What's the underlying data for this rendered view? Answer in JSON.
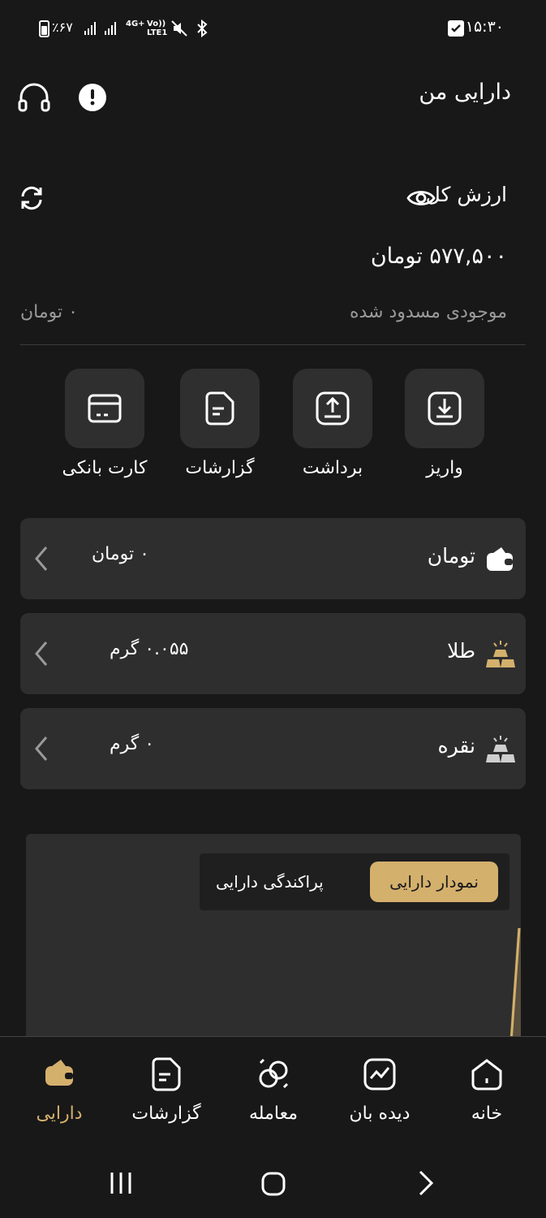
{
  "status_bar": {
    "time": "۱۵:۳۰",
    "battery": "٪۶۷",
    "network": "4G+",
    "volte": "Vo)) LTE1"
  },
  "header": {
    "title": "دارایی من"
  },
  "total": {
    "label": "ارزش کل",
    "amount": "۵۷۷,۵۰۰ تومان",
    "blocked_label": "موجودی مسدود شده",
    "blocked_value": "۰ تومان"
  },
  "actions": [
    {
      "label": "واریز",
      "icon": "deposit-icon"
    },
    {
      "label": "برداشت",
      "icon": "withdraw-icon"
    },
    {
      "label": "گزارشات",
      "icon": "report-icon"
    },
    {
      "label": "کارت بانکی",
      "icon": "card-icon"
    }
  ],
  "assets": [
    {
      "name": "تومان",
      "value": "۰ تومان",
      "icon": "wallet-icon"
    },
    {
      "name": "طلا",
      "value": "۰.۰۵۵ گرم",
      "icon": "gold-bars-icon"
    },
    {
      "name": "نقره",
      "value": "۰ گرم",
      "icon": "silver-bars-icon"
    }
  ],
  "chart_tabs": {
    "active": "نمودار دارایی",
    "inactive": "پراکندگی دارایی"
  },
  "bottom_nav": [
    {
      "label": "خانه",
      "icon": "home-icon"
    },
    {
      "label": "دیده بان",
      "icon": "watchlist-icon"
    },
    {
      "label": "معامله",
      "icon": "trade-icon"
    },
    {
      "label": "گزارشات",
      "icon": "report-icon"
    },
    {
      "label": "دارایی",
      "icon": "wallet-icon",
      "active": true
    }
  ],
  "colors": {
    "background": "#181818",
    "card": "#2e2e2e",
    "accent_gold": "#d4b06d",
    "muted_text": "#9a9a9a"
  }
}
